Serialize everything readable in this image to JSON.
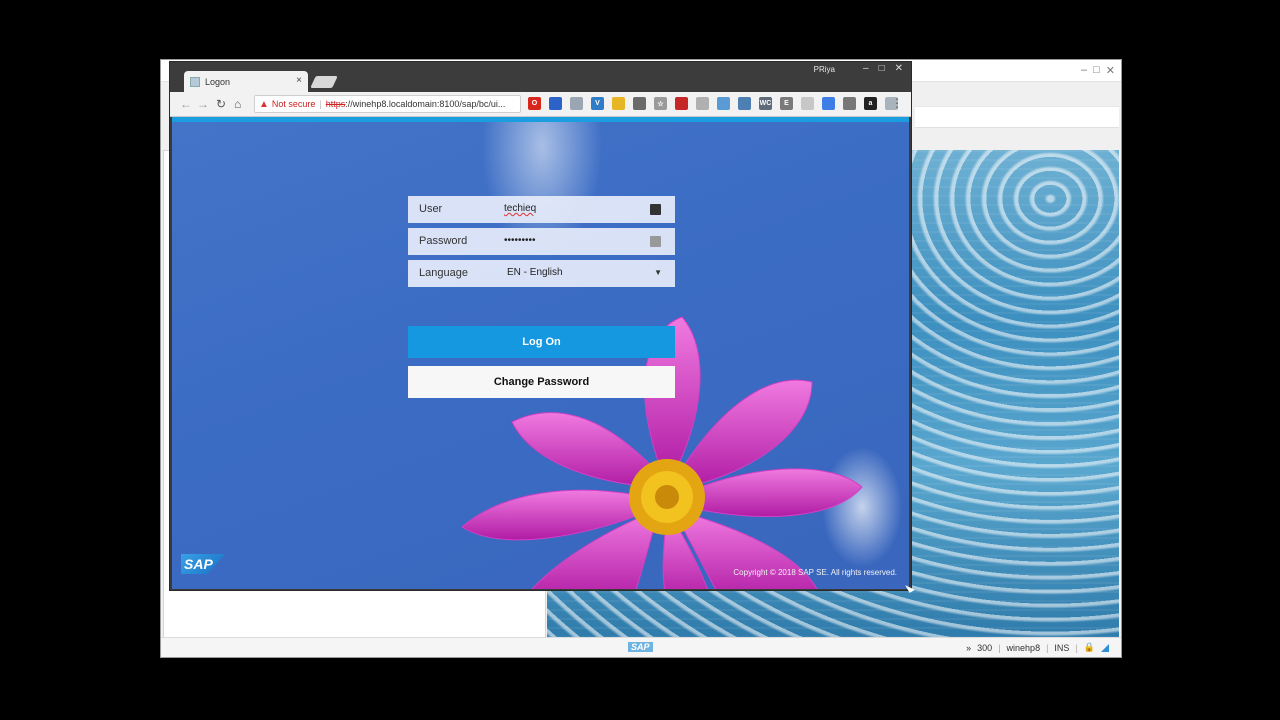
{
  "background_window": {
    "statusbar": {
      "sap_mark": "SAP",
      "chevrons": "»",
      "client": "300",
      "server": "winehp8",
      "mode": "INS"
    }
  },
  "browser": {
    "tab_title": "Logon",
    "tab_close": "×",
    "profile_name": "PRiya",
    "window_controls": [
      "–",
      "□",
      "✕"
    ],
    "security_label": "Not secure",
    "url_protocol": "https",
    "url_rest": "://winehp8.localdomain:8100/sap/bc/ui...",
    "extensions": [
      {
        "name": "opera-ext-icon",
        "color": "#d9261c",
        "glyph": "O"
      },
      {
        "name": "screen-ext-icon",
        "color": "#2c63c9",
        "glyph": ""
      },
      {
        "name": "cast-ext-icon",
        "color": "#9aa6b2",
        "glyph": ""
      },
      {
        "name": "vpn-ext-icon",
        "color": "#2f7cc9",
        "glyph": "V"
      },
      {
        "name": "folder-ext-icon",
        "color": "#e7b624",
        "glyph": ""
      },
      {
        "name": "camera-ext-icon",
        "color": "#6a6a6a",
        "glyph": ""
      },
      {
        "name": "star-icon",
        "color": "#9a9a9a",
        "glyph": "☆"
      },
      {
        "name": "badge-ext-icon",
        "color": "#c62828",
        "glyph": ""
      },
      {
        "name": "puzzle-ext-icon",
        "color": "#b0b0b0",
        "glyph": ""
      },
      {
        "name": "globe-ext-icon",
        "color": "#5a9bd5",
        "glyph": ""
      },
      {
        "name": "grid-ext-icon",
        "color": "#4d7fb3",
        "glyph": ""
      },
      {
        "name": "wc-ext-icon",
        "color": "#5f6b7a",
        "glyph": "WC"
      },
      {
        "name": "doc-ext-icon",
        "color": "#7a7a7a",
        "glyph": "E"
      },
      {
        "name": "table-ext-icon",
        "color": "#c7c7c7",
        "glyph": ""
      },
      {
        "name": "translate-ext-icon",
        "color": "#3d7de6",
        "glyph": ""
      },
      {
        "name": "box-ext-icon",
        "color": "#777777",
        "glyph": ""
      },
      {
        "name": "amazon-ext-icon",
        "color": "#222222",
        "glyph": "a"
      },
      {
        "name": "leaf-ext-icon",
        "color": "#a9b3bb",
        "glyph": ""
      }
    ]
  },
  "logon": {
    "user_label": "User",
    "user_value": "techieq",
    "password_label": "Password",
    "password_value": "•••••••••",
    "language_label": "Language",
    "language_value": "EN - English",
    "logon_button": "Log On",
    "change_password_button": "Change Password",
    "logo": "SAP",
    "copyright": "Copyright © 2018 SAP SE. All rights reserved."
  }
}
